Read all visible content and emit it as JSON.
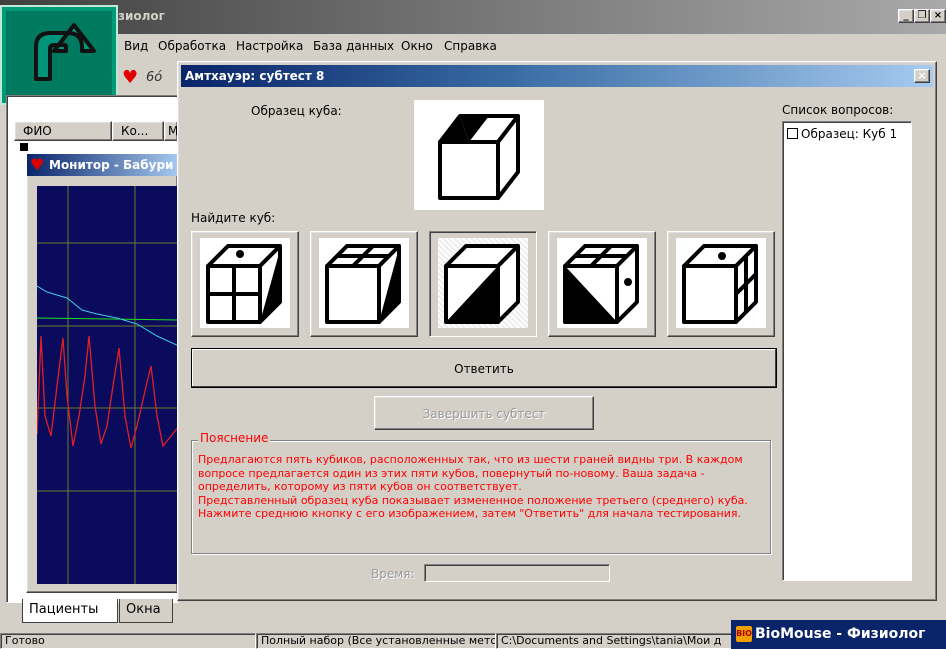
{
  "main_window": {
    "title": "зиолог",
    "controls": {
      "minimize": "_",
      "maximize": "❐",
      "close": "×"
    }
  },
  "menu": [
    "Вид",
    "Обработка",
    "Настройка",
    "База данных",
    "Окно",
    "Справка"
  ],
  "patients_table": {
    "columns": [
      "ФИО",
      "Ко...",
      "М"
    ]
  },
  "monitor": {
    "title": "Монитор - Бабури"
  },
  "bottom_tabs": [
    "Пациенты",
    "Окна"
  ],
  "status_bar": {
    "ready": "Готово",
    "set": "Полный набор (Все установленные метс",
    "path": "C:\\Documents and Settings\\tania\\Мои д"
  },
  "brand": {
    "text": "BioMouse - Физиолог",
    "badge": "BIO"
  },
  "dialog": {
    "title": "Амтхауэр: субтест 8",
    "close": "×",
    "sample_label": "Образец куба:",
    "find_label": "Найдите куб:",
    "answer_button": "Ответить",
    "finish_button": "Завершить субтест",
    "explanation": {
      "legend": "Пояснение",
      "text": "Предлагаются пять кубиков, расположенных так, что из шести граней видны три. В каждом вопросе предлагается один из этих пяти кубов, повернутый по-новому. Ваша задача - определить, которому из пяти кубов он соответствует.\nПредставленный образец куба показывает измененное положение третьего (среднего) куба. Нажмите среднюю кнопку с его изображением, затем \"Ответить\" для начала тестирования."
    },
    "time_label": "Время:",
    "questions_label": "Список вопросов:",
    "questions": [
      {
        "label": "Образец: Куб 1",
        "checked": false
      }
    ],
    "selected_cube": 3
  },
  "colors": {
    "dialog_title": "#0a246a",
    "explanation_text": "#ff0000",
    "logo_green": "#007a5e",
    "monitor_bg": "#0b0b5e"
  }
}
